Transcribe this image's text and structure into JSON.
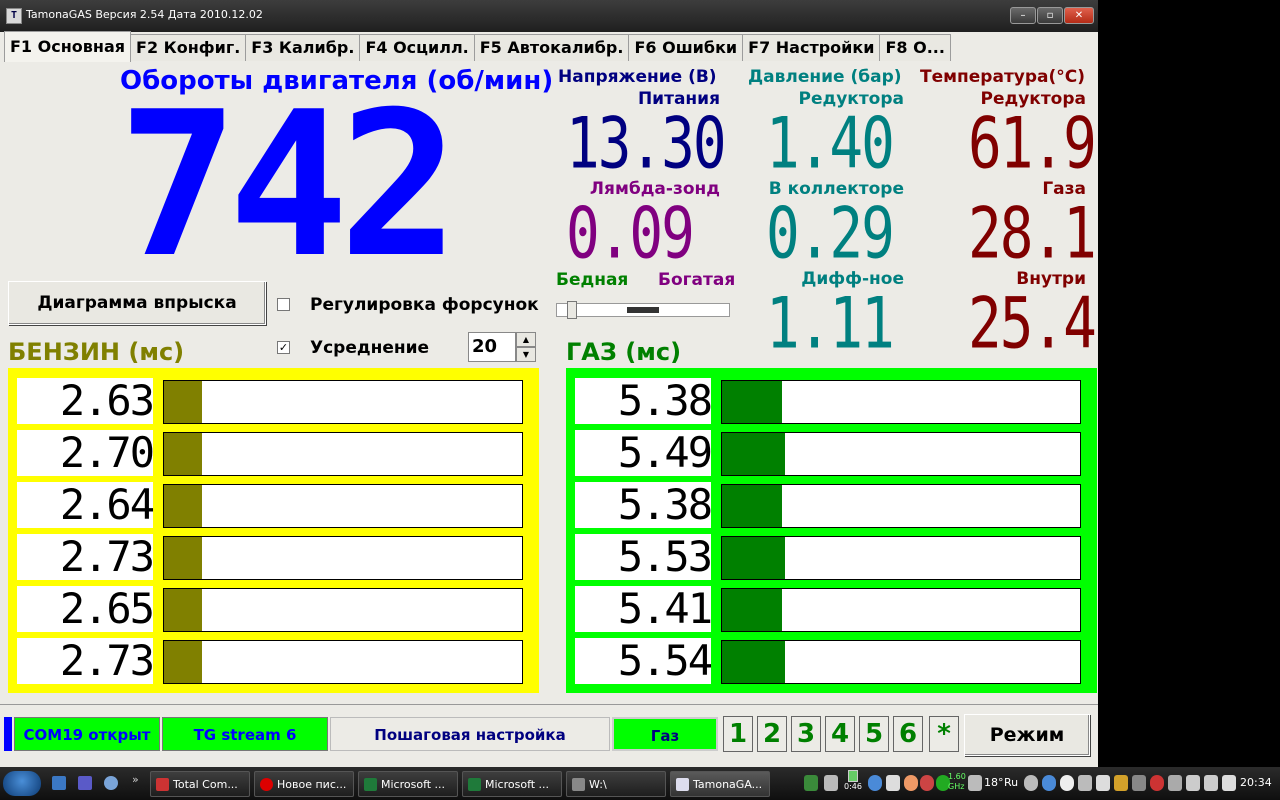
{
  "window": {
    "title": "TamonaGAS  Версия 2.54  Дата 2010.12.02",
    "icon_label": "T",
    "buttons": {
      "minimize": "–",
      "maximize": "▫",
      "close": "✕"
    }
  },
  "tabs": [
    {
      "label": "F1 Основная",
      "active": true
    },
    {
      "label": "F2 Конфиг."
    },
    {
      "label": "F3 Калибр."
    },
    {
      "label": "F4 Осцилл."
    },
    {
      "label": "F5 Автокалибр."
    },
    {
      "label": "F6 Ошибки"
    },
    {
      "label": "F7 Настройки"
    },
    {
      "label": "F8 О..."
    }
  ],
  "rpm": {
    "title": "Обороты двигателя (об/мин)",
    "value": "742"
  },
  "voltage": {
    "title": "Напряжение (В)",
    "supply_label": "Питания",
    "supply_value": "13.30",
    "lambda_label": "Лямбда-зонд",
    "lambda_value": "0.09"
  },
  "pressure": {
    "title": "Давление (бар)",
    "reducer_label": "Редуктора",
    "reducer_value": "1.40",
    "manifold_label": "В коллекторе",
    "manifold_value": "0.29",
    "diff_label": "Дифф-ное",
    "diff_value": "1.11"
  },
  "temperature": {
    "title": "Температура(°С)",
    "reducer_label": "Редуктора",
    "reducer_value": "61.9",
    "gas_label": "Газа",
    "gas_value": "28.1",
    "inside_label": "Внутри",
    "inside_value": "25.4"
  },
  "lambda_slider": {
    "lean": "Бедная",
    "rich": "Богатая",
    "level": 0.5
  },
  "controls": {
    "injection_diagram_button": "Диаграмма впрыска",
    "injector_adjust_label": "Регулировка форсунок",
    "injector_adjust_checked": false,
    "averaging_label": "Усреднение",
    "averaging_checked": true,
    "averaging_value": "20",
    "check_mark": "✓",
    "spin_up": "▲",
    "spin_down": "▼"
  },
  "petrol": {
    "title": "БЕНЗИН (мс)",
    "color": "#ffff00",
    "bar_color": "#808000",
    "values": [
      "2.63",
      "2.70",
      "2.64",
      "2.73",
      "2.65",
      "2.73"
    ],
    "fill_fraction": [
      0.105,
      0.105,
      0.105,
      0.105,
      0.105,
      0.105
    ]
  },
  "gas": {
    "title": "ГАЗ (мс)",
    "color": "#00ff00",
    "bar_color": "#008000",
    "values": [
      "5.38",
      "5.49",
      "5.38",
      "5.53",
      "5.41",
      "5.54"
    ],
    "fill_fraction": [
      0.167,
      0.175,
      0.167,
      0.175,
      0.167,
      0.175
    ]
  },
  "status": {
    "com": "COM19 открыт",
    "stream": "TG stream 6",
    "step_tuning": "Пошаговая настройка",
    "fuel": "Газ",
    "cylinders": [
      "1",
      "2",
      "3",
      "4",
      "5",
      "6"
    ],
    "asterisk": "*",
    "mode_button": "Режим"
  },
  "taskbar": {
    "items": [
      {
        "label": "Total Com..."
      },
      {
        "label": "Новое пис..."
      },
      {
        "label": "Microsoft ..."
      },
      {
        "label": "Microsoft ..."
      },
      {
        "label": "W:\\"
      },
      {
        "label": "TamonaGA...",
        "active": true
      }
    ],
    "tray_temp": "18°",
    "tray_lang": "Ru",
    "cpu_freq": "1.60 GHz",
    "battery_time": "0:46",
    "clock": "20:34"
  }
}
